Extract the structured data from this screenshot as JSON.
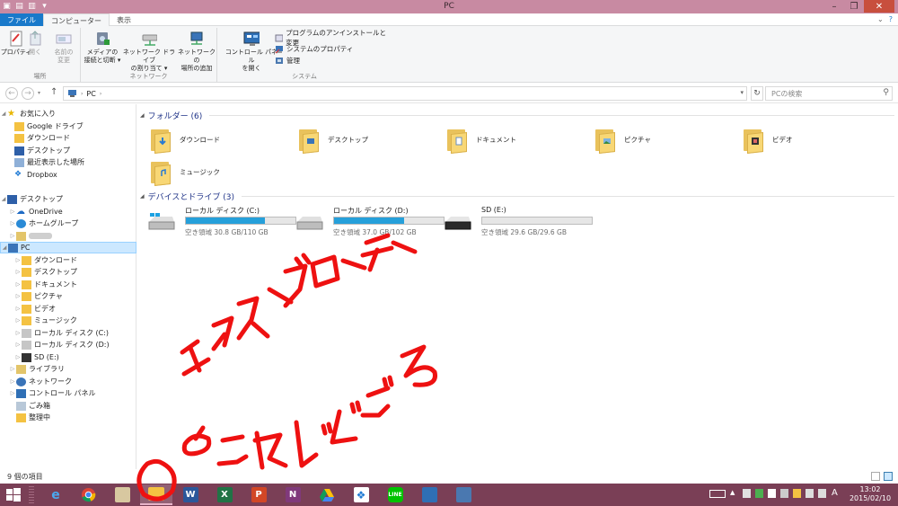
{
  "window": {
    "title": "PC"
  },
  "tabs": {
    "file": "ファイル",
    "computer": "コンピューター",
    "view": "表示"
  },
  "ribbon": {
    "location": {
      "label": "場所",
      "properties": "プロパティ",
      "open": "開く",
      "rename": "名前の\n変更"
    },
    "network": {
      "label": "ネットワーク",
      "media": "メディアの\n接続と切断 ▾",
      "map_drive": "ネットワーク ドライブ\nの割り当て ▾",
      "add_location": "ネットワークの\n場所の追加"
    },
    "system": {
      "label": "システム",
      "control_panel": "コントロール パネル\nを開く",
      "uninstall": "プログラムのアンインストールと変更",
      "sys_props": "システムのプロパティ",
      "manage": "管理"
    }
  },
  "address": {
    "path": "PC",
    "search_placeholder": "PCの検索"
  },
  "nav": {
    "favorites": "お気に入り",
    "fav_items": [
      "Google ドライブ",
      "ダウンロード",
      "デスクトップ",
      "最近表示した場所",
      "Dropbox"
    ],
    "desktop": "デスクトップ",
    "desk_items": [
      "OneDrive",
      "ホームグループ"
    ],
    "pc": "PC",
    "pc_items": [
      "ダウンロード",
      "デスクトップ",
      "ドキュメント",
      "ピクチャ",
      "ビデオ",
      "ミュージック",
      "ローカル ディスク (C:)",
      "ローカル ディスク (D:)",
      "SD (E:)"
    ],
    "other_items": [
      "ライブラリ",
      "ネットワーク",
      "コントロール パネル",
      "ごみ箱",
      "整理中"
    ]
  },
  "content": {
    "folders_header": "フォルダー (6)",
    "folders": [
      "ダウンロード",
      "デスクトップ",
      "ドキュメント",
      "ピクチャ",
      "ビデオ",
      "ミュージック"
    ],
    "drives_header": "デバイスとドライブ (3)",
    "drives": [
      {
        "name": "ローカル ディスク (C:)",
        "free": "空き領域 30.8 GB/110 GB",
        "used_fraction": 0.72
      },
      {
        "name": "ローカル ディスク (D:)",
        "free": "空き領域 37.0 GB/102 GB",
        "used_fraction": 0.64
      },
      {
        "name": "SD (E:)",
        "free": "空き領域 29.6 GB/29.6 GB",
        "used_fraction": 0.0
      }
    ]
  },
  "status": {
    "count": "9 個の項目"
  },
  "taskbar": {
    "ime": "A",
    "time": "13:02",
    "date": "2015/02/10"
  },
  "colors": {
    "accent": "#1979ca",
    "titlebar": "#c88aa2",
    "taskbar": "#7a3f56",
    "drive_bar": "#26a0da",
    "annotation": "#ee1111"
  }
}
